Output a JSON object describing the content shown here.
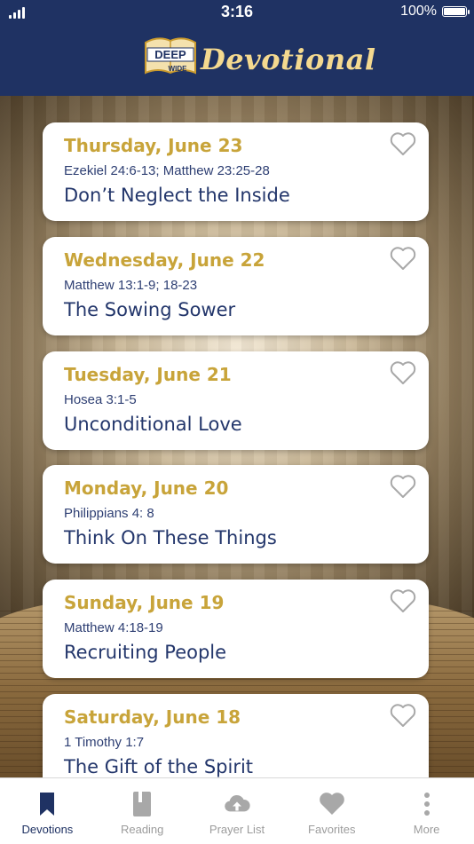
{
  "status": {
    "time": "3:16",
    "battery": "100%"
  },
  "header": {
    "logo_top": "DEEP",
    "logo_bottom": "WIDE",
    "title": "Devotional"
  },
  "devotions": [
    {
      "date": "Thursday, June 23",
      "reference": "Ezekiel 24:6-13; Matthew 23:25-28",
      "title": "Don’t Neglect the Inside"
    },
    {
      "date": "Wednesday, June 22",
      "reference": "Matthew 13:1-9; 18-23",
      "title": "The Sowing Sower"
    },
    {
      "date": "Tuesday, June 21",
      "reference": "Hosea 3:1-5",
      "title": "Unconditional Love"
    },
    {
      "date": "Monday, June 20",
      "reference": "Philippians 4: 8",
      "title": "Think On These Things"
    },
    {
      "date": "Sunday, June 19",
      "reference": "Matthew 4:18-19",
      "title": "Recruiting People"
    },
    {
      "date": "Saturday, June 18",
      "reference": "1 Timothy 1:7",
      "title": "The Gift of the Spirit"
    }
  ],
  "tabs": [
    {
      "label": "Devotions",
      "icon": "bookmark-icon",
      "active": true
    },
    {
      "label": "Reading",
      "icon": "book-icon",
      "active": false
    },
    {
      "label": "Prayer List",
      "icon": "cloud-upload-icon",
      "active": false
    },
    {
      "label": "Favorites",
      "icon": "heart-icon",
      "active": false
    },
    {
      "label": "More",
      "icon": "more-vertical-icon",
      "active": false
    }
  ],
  "colors": {
    "navy": "#1f3263",
    "gold": "#c8a43a",
    "inactive": "#9c9c9c"
  }
}
